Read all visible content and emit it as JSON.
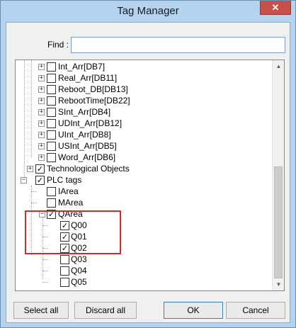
{
  "window": {
    "title": "Tag Manager",
    "close_glyph": "✕"
  },
  "find": {
    "label": "Find :",
    "value": "",
    "placeholder": ""
  },
  "tree": {
    "items": [
      {
        "label": "Int_Arr[DB7]",
        "checked": false
      },
      {
        "label": "Real_Arr[DB11]",
        "checked": false
      },
      {
        "label": "Reboot_DB[DB13]",
        "checked": false
      },
      {
        "label": "RebootTime[DB22]",
        "checked": false
      },
      {
        "label": "SInt_Arr[DB4]",
        "checked": false
      },
      {
        "label": "UDInt_Arr[DB12]",
        "checked": false
      },
      {
        "label": "UInt_Arr[DB8]",
        "checked": false
      },
      {
        "label": "USInt_Arr[DB5]",
        "checked": false
      },
      {
        "label": "Word_Arr[DB6]",
        "checked": false
      },
      {
        "label": "Technological Objects",
        "checked": true
      },
      {
        "label": "PLC tags",
        "checked": true
      },
      {
        "label": "IArea",
        "checked": false
      },
      {
        "label": "MArea",
        "checked": false
      },
      {
        "label": "QArea",
        "checked": true
      },
      {
        "label": "Q00",
        "checked": true
      },
      {
        "label": "Q01",
        "checked": true
      },
      {
        "label": "Q02",
        "checked": true
      },
      {
        "label": "Q03",
        "checked": false
      },
      {
        "label": "Q04",
        "checked": false
      },
      {
        "label": "Q05",
        "checked": false
      }
    ],
    "expand_plus": "+",
    "expand_minus": "−",
    "check_glyph": "✓"
  },
  "buttons": {
    "select_all": "Select all",
    "discard_all": "Discard all",
    "ok": "OK",
    "cancel": "Cancel"
  },
  "colors": {
    "highlight": "#d12a2a",
    "titlebar": "#b4d3f0",
    "close": "#c7504b"
  }
}
